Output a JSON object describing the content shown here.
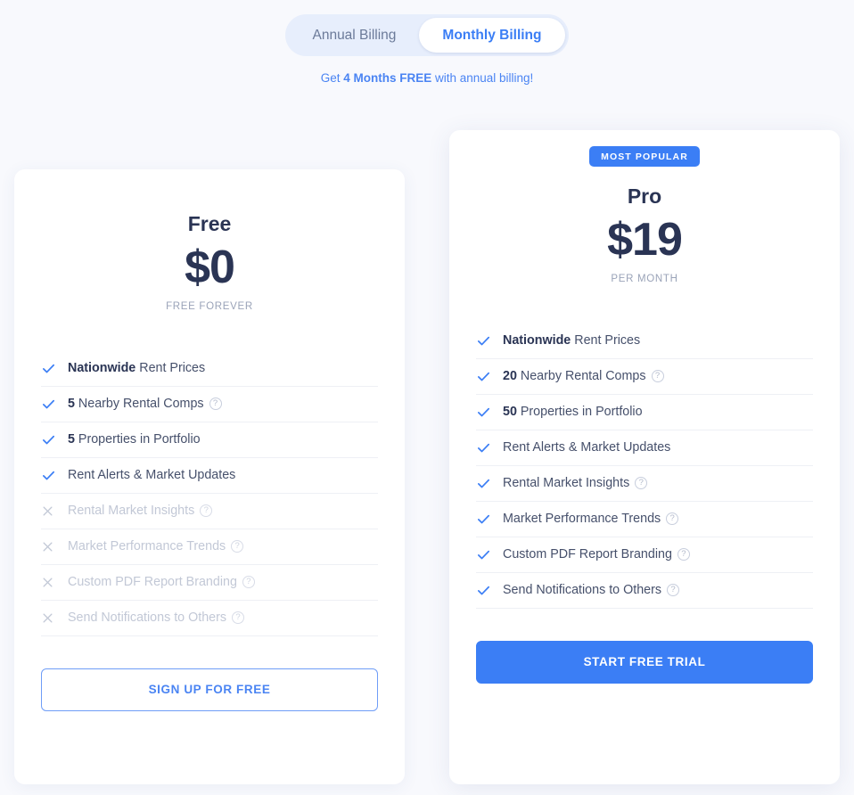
{
  "billing_toggle": {
    "options": [
      {
        "label": "Annual Billing",
        "active": false
      },
      {
        "label": "Monthly Billing",
        "active": true
      }
    ]
  },
  "promo": {
    "prefix": "Get ",
    "highlight": "4 Months FREE",
    "suffix": " with annual billing!"
  },
  "colors": {
    "accent": "#3b7ef5",
    "accent_text": "#4a84f3",
    "page_bg": "#f8f9fd",
    "card_bg": "#ffffff",
    "heading": "#2a3454",
    "muted": "#9aa3b8",
    "disabled": "#c2c8d6",
    "divider": "#eef0f5",
    "toggle_bg": "#e7eefc"
  },
  "plans": [
    {
      "name": "Free",
      "badge": null,
      "price": "$0",
      "price_note": "FREE FOREVER",
      "cta": {
        "label": "SIGN UP FOR FREE",
        "style": "outline"
      },
      "features": [
        {
          "enabled": true,
          "strong": "Nationwide",
          "text": " Rent Prices",
          "help": false
        },
        {
          "enabled": true,
          "strong": "5",
          "text": " Nearby Rental Comps",
          "help": true
        },
        {
          "enabled": true,
          "strong": "5",
          "text": " Properties in Portfolio",
          "help": false
        },
        {
          "enabled": true,
          "strong": "",
          "text": "Rent Alerts & Market Updates",
          "help": false
        },
        {
          "enabled": false,
          "strong": "",
          "text": "Rental Market Insights",
          "help": true
        },
        {
          "enabled": false,
          "strong": "",
          "text": "Market Performance Trends",
          "help": true
        },
        {
          "enabled": false,
          "strong": "",
          "text": "Custom PDF Report Branding",
          "help": true
        },
        {
          "enabled": false,
          "strong": "",
          "text": "Send Notifications to Others",
          "help": true
        }
      ]
    },
    {
      "name": "Pro",
      "badge": "MOST POPULAR",
      "price": "$19",
      "price_note": "PER MONTH",
      "cta": {
        "label": "START FREE TRIAL",
        "style": "solid"
      },
      "features": [
        {
          "enabled": true,
          "strong": "Nationwide",
          "text": " Rent Prices",
          "help": false
        },
        {
          "enabled": true,
          "strong": "20",
          "text": " Nearby Rental Comps",
          "help": true
        },
        {
          "enabled": true,
          "strong": "50",
          "text": " Properties in Portfolio",
          "help": false
        },
        {
          "enabled": true,
          "strong": "",
          "text": "Rent Alerts & Market Updates",
          "help": false
        },
        {
          "enabled": true,
          "strong": "",
          "text": "Rental Market Insights",
          "help": true
        },
        {
          "enabled": true,
          "strong": "",
          "text": "Market Performance Trends",
          "help": true
        },
        {
          "enabled": true,
          "strong": "",
          "text": "Custom PDF Report Branding",
          "help": true
        },
        {
          "enabled": true,
          "strong": "",
          "text": "Send Notifications to Others",
          "help": true
        }
      ]
    }
  ],
  "icons": {
    "check": "check-icon",
    "cross": "cross-icon",
    "help": "help-circle-icon"
  }
}
